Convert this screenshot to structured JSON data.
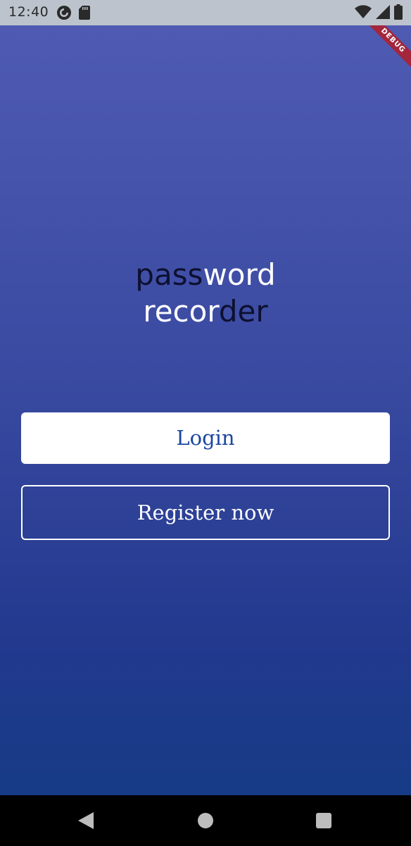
{
  "status_bar": {
    "time": "12:40",
    "left_icons": [
      "pocket-casts-icon",
      "sd-card-icon"
    ],
    "right_icons": [
      "wifi-icon",
      "signal-icon",
      "battery-icon"
    ]
  },
  "debug_banner": "DEBUG",
  "title": {
    "line1": [
      {
        "text": "pass",
        "style": "dark"
      },
      {
        "text": "word",
        "style": "light"
      }
    ],
    "line2": [
      {
        "text": "recor",
        "style": "light"
      },
      {
        "text": "der",
        "style": "dark"
      }
    ]
  },
  "buttons": {
    "login": "Login",
    "register": "Register now"
  },
  "nav_bar": {
    "icons": [
      "back-icon",
      "home-icon",
      "recents-icon"
    ]
  },
  "colors": {
    "gradient_top": "#4f5bb2",
    "gradient_bottom": "#173b86",
    "title_dark": "#0d1030",
    "login_text": "#1d47a0",
    "debug_banner": "#a3263d"
  }
}
